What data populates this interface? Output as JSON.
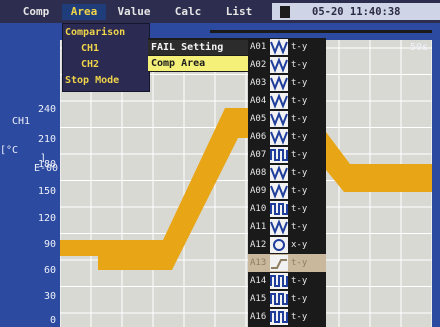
{
  "menubar": {
    "items": [
      "Comp",
      "Area",
      "Value",
      "Calc",
      "List"
    ],
    "active": "Area",
    "datetime": "05-20 11:40:38"
  },
  "area_menu": {
    "items": [
      "Comparison",
      "CH1",
      "CH2",
      "Stop Mode"
    ]
  },
  "submenu": {
    "items": [
      "FAIL Setting",
      "Comp Area"
    ],
    "selected": "Comp Area"
  },
  "axis": {
    "channel": "CH1",
    "unit": "[°C",
    "unit_suffix": "]",
    "exponent": "E-00",
    "ticks": [
      "240",
      "210",
      "180",
      "150",
      "120",
      "90",
      "60",
      "30",
      "0"
    ]
  },
  "plot": {
    "timespan": "50s",
    "band_color": "#e8a616",
    "grid_color": "#ffffff"
  },
  "areas": [
    {
      "id": "A01",
      "type": "t-y",
      "icon": "waveform-w-icon"
    },
    {
      "id": "A02",
      "type": "t-y",
      "icon": "waveform-w-icon"
    },
    {
      "id": "A03",
      "type": "t-y",
      "icon": "waveform-w-icon"
    },
    {
      "id": "A04",
      "type": "t-y",
      "icon": "waveform-w-icon"
    },
    {
      "id": "A05",
      "type": "t-y",
      "icon": "waveform-w-icon"
    },
    {
      "id": "A06",
      "type": "t-y",
      "icon": "waveform-w-icon"
    },
    {
      "id": "A07",
      "type": "t-y",
      "icon": "waveform-pulse-icon"
    },
    {
      "id": "A08",
      "type": "t-y",
      "icon": "waveform-w-icon"
    },
    {
      "id": "A09",
      "type": "t-y",
      "icon": "waveform-w-icon"
    },
    {
      "id": "A10",
      "type": "t-y",
      "icon": "waveform-pulse-icon"
    },
    {
      "id": "A11",
      "type": "t-y",
      "icon": "waveform-w-icon"
    },
    {
      "id": "A12",
      "type": "x-y",
      "icon": "circle-icon"
    },
    {
      "id": "A13",
      "type": "t-y",
      "icon": "waveform-step-icon",
      "selected": true
    },
    {
      "id": "A14",
      "type": "t-y",
      "icon": "waveform-pulse-icon"
    },
    {
      "id": "A15",
      "type": "t-y",
      "icon": "waveform-pulse-icon"
    },
    {
      "id": "A16",
      "type": "t-y",
      "icon": "waveform-pulse-icon"
    }
  ]
}
